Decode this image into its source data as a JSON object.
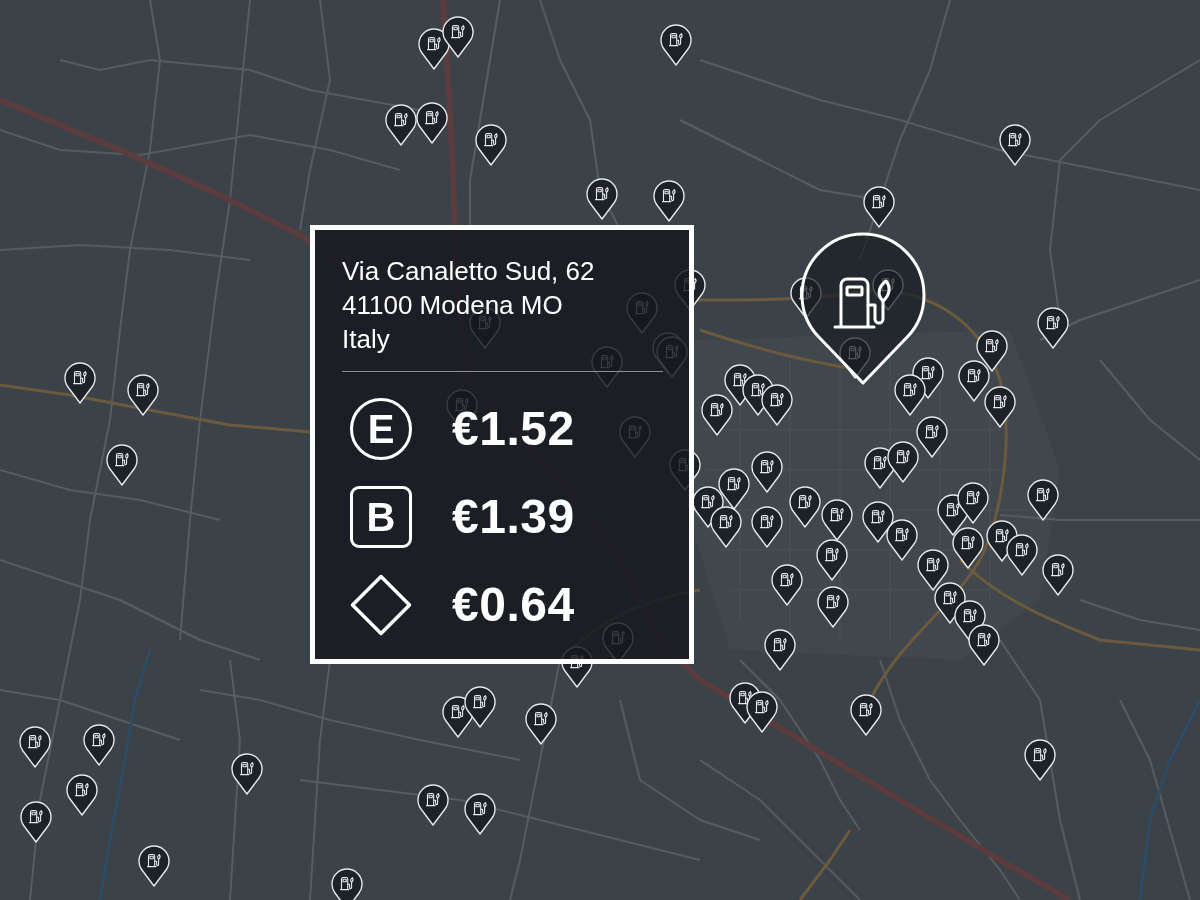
{
  "station_card": {
    "address_lines": [
      "Via Canaletto Sud, 62",
      "41100 Modena MO",
      "Italy"
    ],
    "prices": [
      {
        "kind": "circle",
        "fuel_label": "E",
        "price": "€1.52"
      },
      {
        "kind": "square",
        "fuel_label": "B",
        "price": "€1.39"
      },
      {
        "kind": "diamond",
        "price": "€0.64"
      }
    ]
  }
}
